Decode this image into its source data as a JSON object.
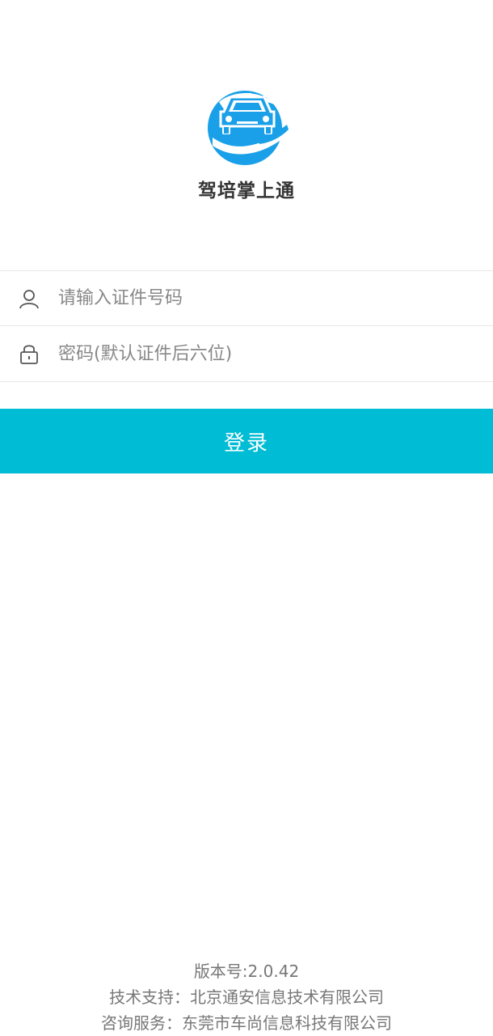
{
  "app": {
    "name": "驾培掌上通",
    "logo_icon": "car-in-hand-logo",
    "brand_color": "#1aa0e8"
  },
  "login": {
    "id_field": {
      "icon": "user-icon",
      "value": "",
      "placeholder": "请输入证件号码"
    },
    "password_field": {
      "icon": "lock-icon",
      "value": "",
      "placeholder": "密码(默认证件后六位)"
    },
    "submit_label": "登录",
    "submit_color": "#00bcd4"
  },
  "footer": {
    "version": "版本号:2.0.42",
    "tech_support": "技术支持：北京通安信息技术有限公司",
    "consulting": "咨询服务：东莞市车尚信息科技有限公司"
  }
}
